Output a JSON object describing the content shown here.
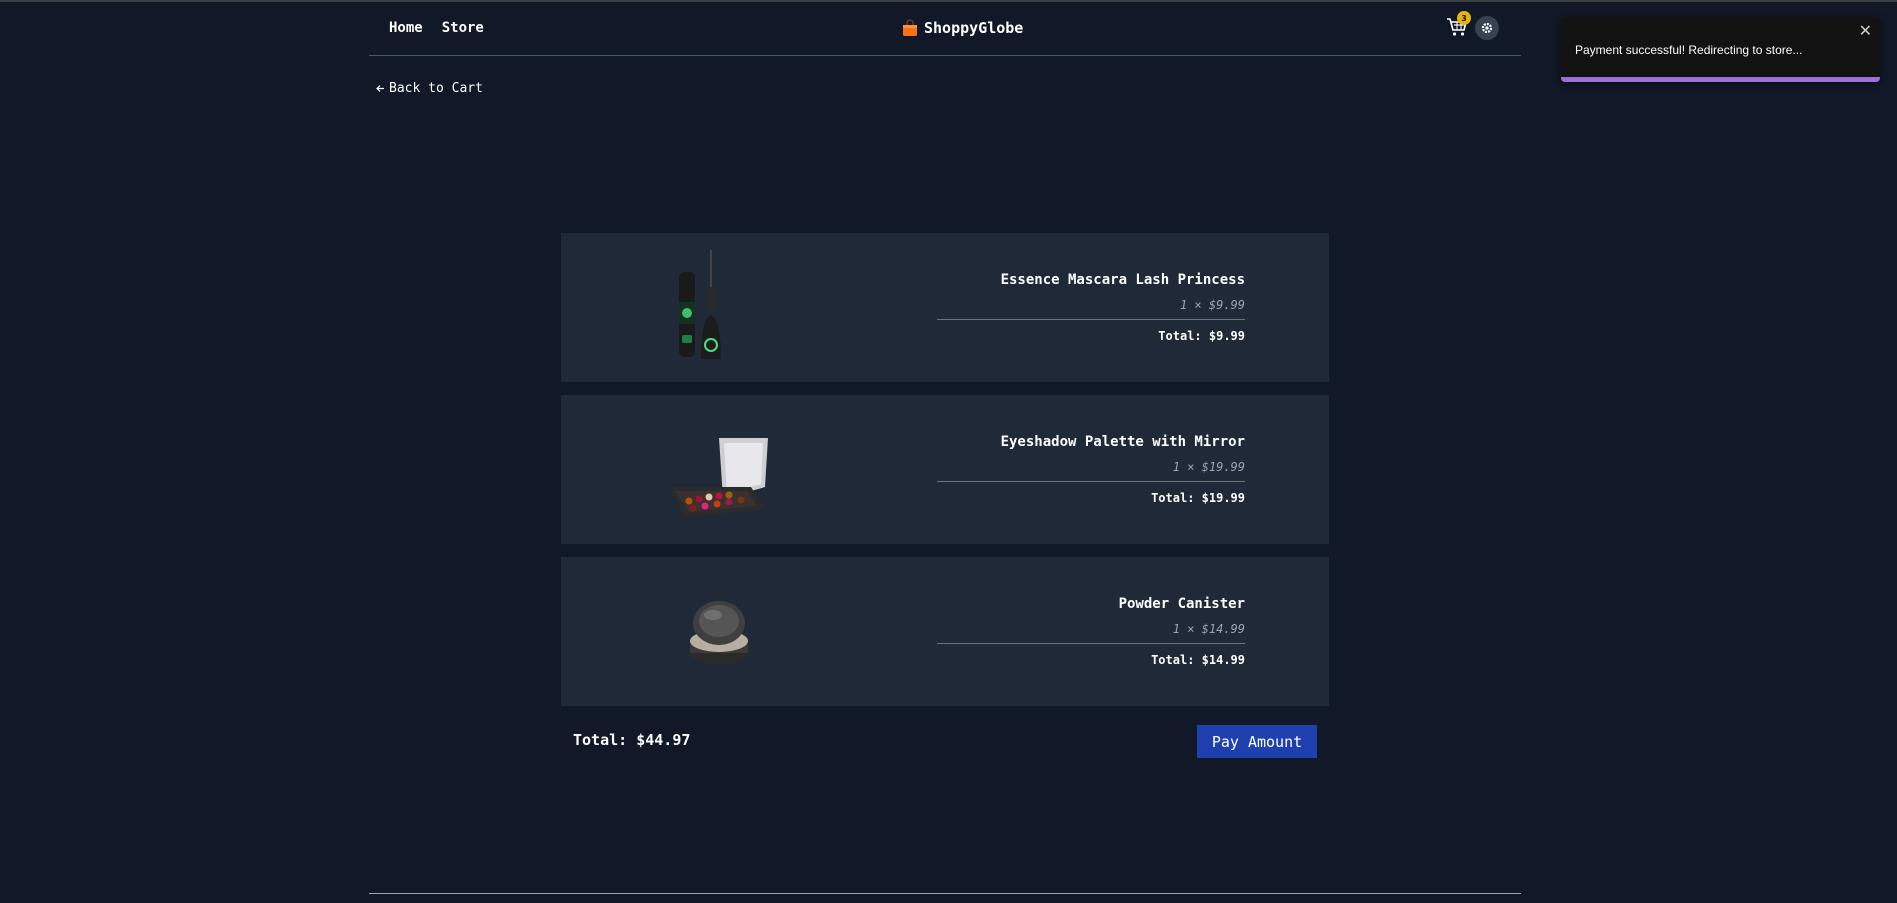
{
  "header": {
    "nav": [
      {
        "label": "Home"
      },
      {
        "label": "Store"
      }
    ],
    "brand": "ShoppyGlobe",
    "cart_count": "3",
    "icons": {
      "brand": "shopping-bag-icon",
      "cart": "cart-icon",
      "theme": "gear-icon"
    }
  },
  "back_link": {
    "label": "Back to Cart",
    "icon": "arrow-left-icon"
  },
  "items": [
    {
      "name": "Essence Mascara Lash Princess",
      "qty_price": "1 × $9.99",
      "total": "Total: $9.99",
      "image": "mascara-image"
    },
    {
      "name": "Eyeshadow Palette with Mirror",
      "qty_price": "1 × $19.99",
      "total": "Total: $19.99",
      "image": "eyeshadow-palette-image"
    },
    {
      "name": "Powder Canister",
      "qty_price": "1 × $14.99",
      "total": "Total: $14.99",
      "image": "powder-canister-image"
    }
  ],
  "summary": {
    "total": "Total: $44.97",
    "pay_label": "Pay Amount"
  },
  "toast": {
    "message": "Payment successful! Redirecting to store...",
    "progress": 1.0
  },
  "colors": {
    "background": "#111827",
    "card": "#1f2937",
    "accent": "#1e40af",
    "badge": "#eab308",
    "toast_progress": "#9b6fd6"
  }
}
